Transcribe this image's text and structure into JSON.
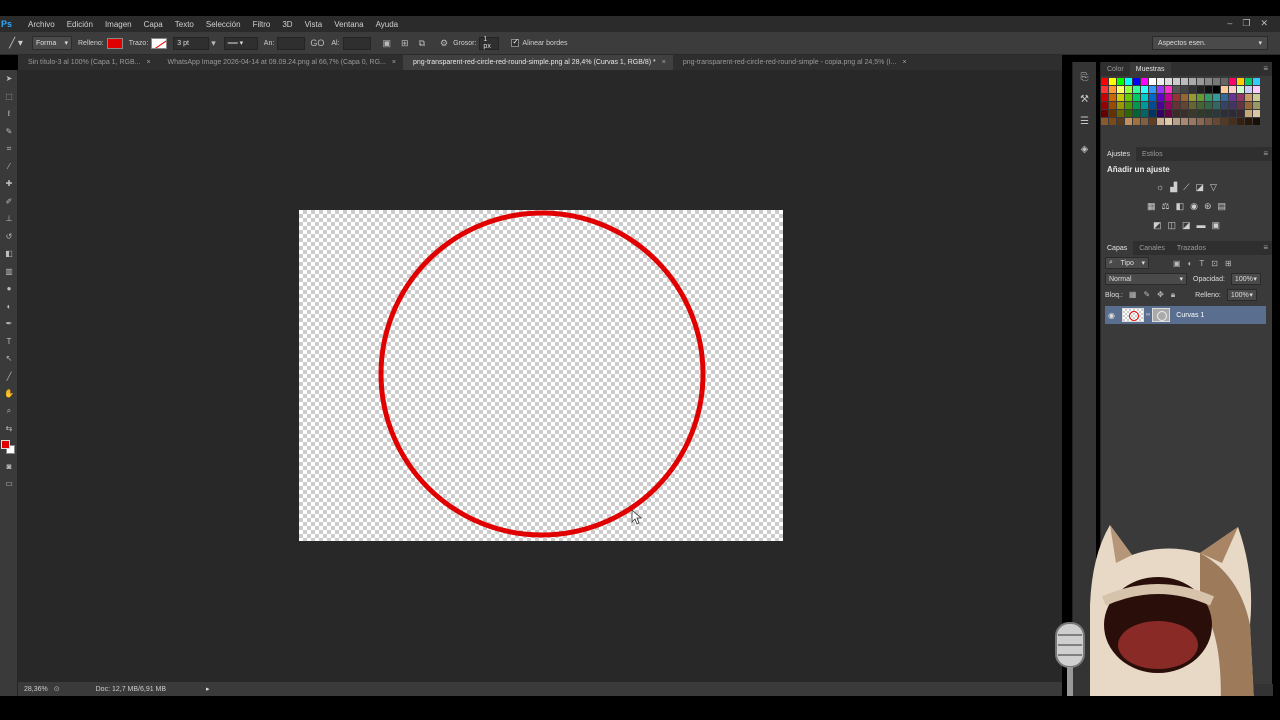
{
  "app": {
    "logo": "Ps"
  },
  "menu": [
    "Archivo",
    "Edición",
    "Imagen",
    "Capa",
    "Texto",
    "Selección",
    "Filtro",
    "3D",
    "Vista",
    "Ventana",
    "Ayuda"
  ],
  "options": {
    "tool_mode": "Forma",
    "fill_label": "Relleno:",
    "stroke_label": "Trazo:",
    "stroke_size": "3 pt",
    "width_label": "An:",
    "height_label": "Al:",
    "link_symbol": "GO",
    "thickness_label": "Grosor:",
    "thickness_value": "1 px",
    "align_edges": "Alinear bordes",
    "workspace": "Aspectos esen."
  },
  "tabs": [
    {
      "label": "Sin título-3 al 100% (Capa 1, RGB...",
      "active": false
    },
    {
      "label": "WhatsApp Image 2026-04-14 at 09.09.24.png al 66,7% (Capa 0, RG...",
      "active": false
    },
    {
      "label": "png-transparent-red-circle-red-round-simple.png al 28,4% (Curvas 1, RGB/8) *",
      "active": true
    },
    {
      "label": "png-transparent-red-circle-red-round-simple - copia.png al 24,5% (I...",
      "active": false
    }
  ],
  "status": {
    "zoom": "28,36%",
    "doc": "Doc: 12,7 MB/6,91 MB"
  },
  "panels": {
    "color_tab": "Color",
    "swatches_tab": "Muestras",
    "adjustments_tab": "Ajustes",
    "styles_tab": "Estilos",
    "add_adjustment": "Añadir un ajuste",
    "layers_tab": "Capas",
    "channels_tab": "Canales",
    "paths_tab": "Trazados",
    "kind_filter": "Tipo",
    "blend_mode": "Normal",
    "opacity_label": "Opacidad:",
    "opacity_value": "100%",
    "lock_label": "Bloq.:",
    "fill_label": "Relleno:",
    "fill_value": "100%",
    "layer_name": "Curvas 1"
  },
  "colors": {
    "accent_red": "#e00000",
    "layer_selected": "#5a6f8f",
    "ps_blue": "#31a8ff"
  }
}
